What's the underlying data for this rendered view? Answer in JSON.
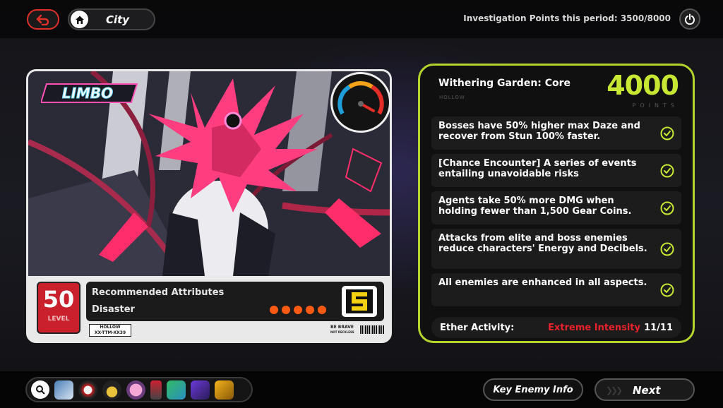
{
  "header": {
    "location": "City",
    "investigation_label": "Investigation Points this period:",
    "investigation_value": "3500/8000"
  },
  "card": {
    "boss_logo": "LIMBO",
    "level": "50",
    "level_label": "LEVEL",
    "attributes_title": "Recommended Attributes",
    "attribute": "Disaster",
    "difficulty_dots": 5,
    "hollow_tag_line1": "HOLLOW",
    "hollow_tag_line2": "XX-TTM-XX39",
    "brave_line1": "BE BRAVE",
    "brave_line2": "NOT RECKLESS"
  },
  "objective": {
    "title": "Withering Garden: Core",
    "subtitle": "HOLLOW",
    "points": "4000",
    "points_label": "POINTS",
    "rules": [
      "Bosses have 50% higher max Daze and recover from Stun 100% faster.",
      "[Chance Encounter] A series of events entailing unavoidable risks",
      "Agents take 50% more DMG when holding fewer than 1,500 Gear Coins.",
      "Attacks from elite and boss enemies reduce characters' Energy and Decibels.",
      "All enemies are enhanced in all aspects."
    ],
    "ether_label": "Ether Activity:",
    "ether_intensity": "Extreme Intensity",
    "ether_count": "11/11"
  },
  "footer": {
    "key_enemy_label": "Key Enemy Info",
    "next_label": "Next",
    "dock_icons": [
      "search-icon",
      "agent-card-icon",
      "bangboo-icon",
      "hat-icon",
      "pink-bunny-icon",
      "drink-icon",
      "calculator-icon",
      "purple-book-icon",
      "gold-book-icon"
    ]
  },
  "colors": {
    "accent_green": "#b3d42c",
    "points_green": "#c6e833",
    "alert_red": "#e8212c",
    "level_red": "#c9202b",
    "dot_orange": "#ff5a14"
  }
}
